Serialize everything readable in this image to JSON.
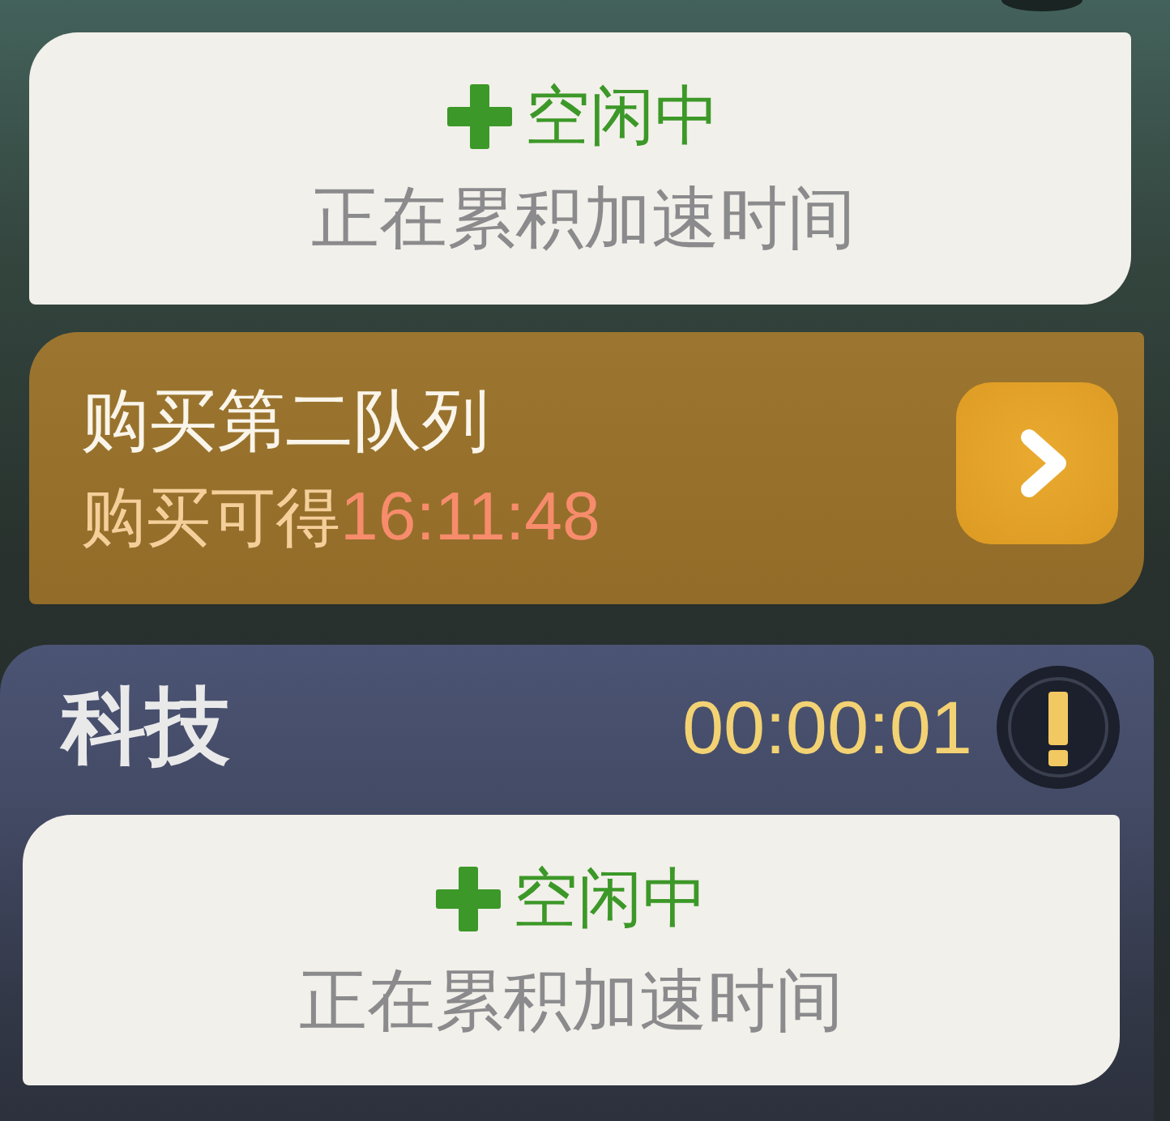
{
  "top_card": {
    "status": "空闲中",
    "note": "正在累积加速时间"
  },
  "purchase_banner": {
    "title": "购买第二队列",
    "reward_label": "购买可得",
    "reward_time": "16:11:48"
  },
  "tech_section": {
    "title": "科技",
    "timer": "00:00:01",
    "card": {
      "status": "空闲中",
      "note": "正在累积加速时间"
    }
  }
}
